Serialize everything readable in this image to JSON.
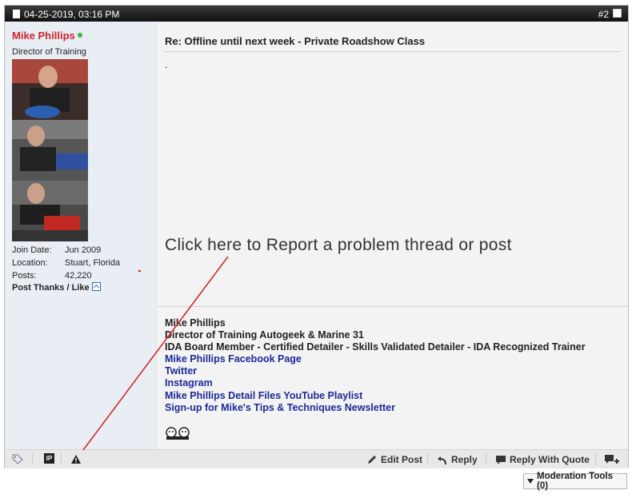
{
  "post": {
    "date": "04-25-2019, 03:16 PM",
    "number": "#2",
    "title": "Re: Offline until next week - Private Roadshow Class",
    "body": "."
  },
  "user": {
    "name": "Mike Phillips",
    "title": "Director of Training",
    "details": [
      {
        "label": "Join Date:",
        "value": "Jun 2009"
      },
      {
        "label": "Location:",
        "value": "Stuart, Florida"
      },
      {
        "label": "Posts:",
        "value": "42,220"
      }
    ],
    "thanks_label": "Post Thanks / Like"
  },
  "annotation": {
    "text": "Click here to Report a problem thread or post",
    "color": "#d22a2a"
  },
  "signature": {
    "lines": [
      "Mike Phillips",
      "Director of Training Autogeek & Marine 31",
      "IDA Board Member - Certified Detailer - Skills Validated Detailer - IDA Recognized Trainer"
    ],
    "links": [
      "Mike Phillips Facebook Page",
      "Twitter",
      "Instagram",
      "Mike Phillips Detail Files YouTube Playlist",
      "Sign-up for Mike's Tips & Techniques Newsletter"
    ]
  },
  "footer": {
    "ip_label": "IP",
    "edit_label": "Edit Post",
    "reply_label": "Reply",
    "quote_label": "Reply With Quote"
  },
  "moderation": {
    "label": "Moderation Tools (0)"
  },
  "colors": {
    "username": "#d2232a",
    "link": "#1a2a9a",
    "header": "#1c1c1c",
    "sidebar": "#e9eef5"
  }
}
